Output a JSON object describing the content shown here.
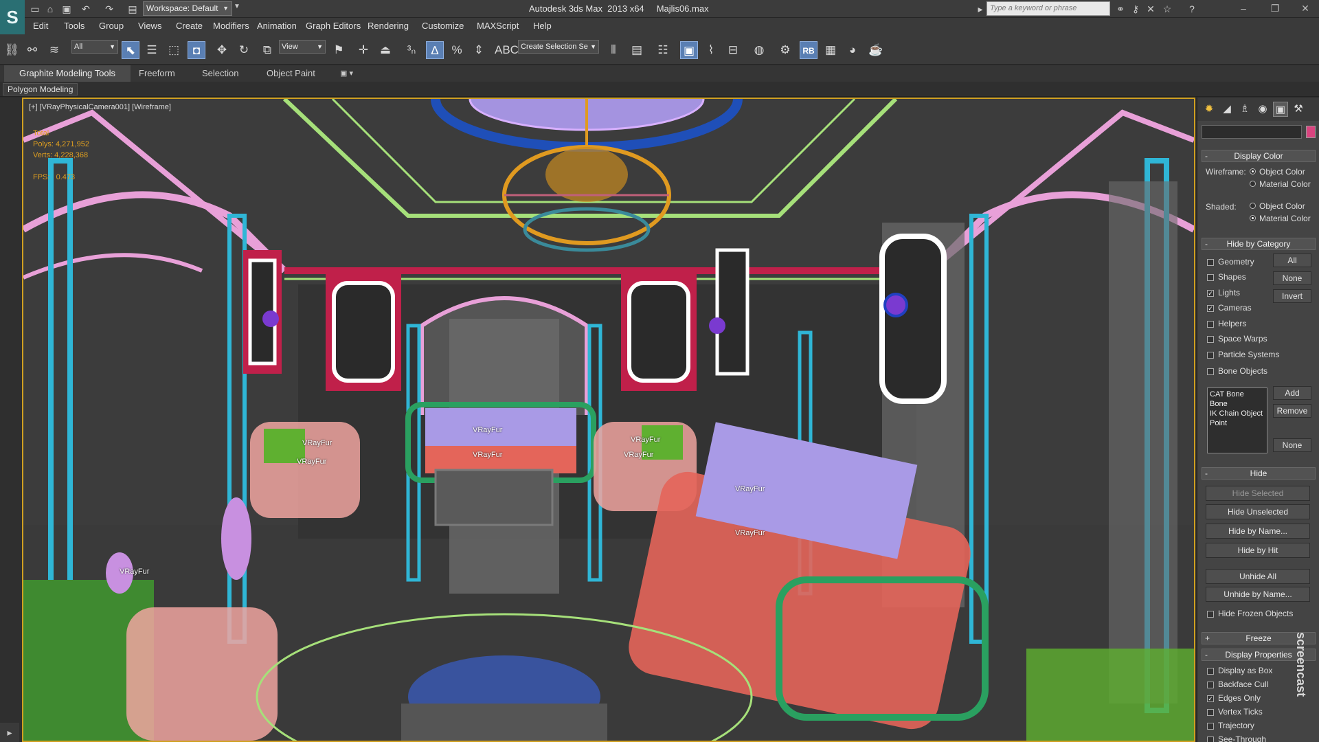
{
  "titlebar": {
    "workspace": "Workspace: Default",
    "app_title": "Autodesk 3ds Max  2013 x64     Majlis06.max",
    "search_placeholder": "Type a keyword or phrase"
  },
  "menu": [
    "Edit",
    "Tools",
    "Group",
    "Views",
    "Create",
    "Modifiers",
    "Animation",
    "Graph Editors",
    "Rendering",
    "Customize",
    "MAXScript",
    "Help"
  ],
  "toolbar": {
    "selection_filter": "All",
    "ref_coord": "View",
    "selection_set": "Create Selection Se",
    "rb_label": "RB",
    "abc_label": "ABC"
  },
  "ribbon": {
    "tabs": [
      "Graphite Modeling Tools",
      "Freeform",
      "Selection",
      "Object Paint"
    ],
    "sub_label": "Polygon Modeling"
  },
  "viewport": {
    "label": "[+] [VRayPhysicalCamera001] [Wireframe]",
    "stats": "Total\nPolys: 4,271,952\nVerts: 4,228,368\n\nFPS:   0.473",
    "fur_labels": [
      "VRayFur",
      "VRayFur",
      "VRayFur",
      "VRayFur",
      "VRayFur",
      "VRayFur",
      "VRayFur",
      "VRayFur",
      "VRayFur"
    ]
  },
  "panel": {
    "display_color": {
      "header": "Display Color",
      "wireframe_label": "Wireframe:",
      "shaded_label": "Shaded:",
      "object_color": "Object Color",
      "material_color": "Material Color"
    },
    "hide_by_category": {
      "header": "Hide by Category",
      "items": [
        {
          "label": "Geometry",
          "checked": false
        },
        {
          "label": "Shapes",
          "checked": false
        },
        {
          "label": "Lights",
          "checked": true
        },
        {
          "label": "Cameras",
          "checked": true
        },
        {
          "label": "Helpers",
          "checked": false
        },
        {
          "label": "Space Warps",
          "checked": false
        },
        {
          "label": "Particle Systems",
          "checked": false
        },
        {
          "label": "Bone Objects",
          "checked": false
        }
      ],
      "all_btn": "All",
      "none_btn": "None",
      "invert_btn": "Invert",
      "list": [
        "CAT Bone",
        "Bone",
        "IK Chain Object",
        "Point"
      ],
      "add_btn": "Add",
      "remove_btn": "Remove",
      "none_btn2": "None"
    },
    "hide": {
      "header": "Hide",
      "buttons": [
        "Hide Selected",
        "Hide Unselected",
        "Hide by Name...",
        "Hide by Hit",
        "Unhide All",
        "Unhide by Name..."
      ],
      "hide_frozen": "Hide Frozen Objects"
    },
    "freeze": {
      "header": "Freeze"
    },
    "display_properties": {
      "header": "Display Properties",
      "items": [
        {
          "label": "Display as Box",
          "checked": false
        },
        {
          "label": "Backface Cull",
          "checked": false
        },
        {
          "label": "Edges Only",
          "checked": true
        },
        {
          "label": "Vertex Ticks",
          "checked": false
        },
        {
          "label": "Trajectory",
          "checked": false
        },
        {
          "label": "See-Through",
          "checked": false
        }
      ]
    }
  },
  "watermark": "screencast"
}
